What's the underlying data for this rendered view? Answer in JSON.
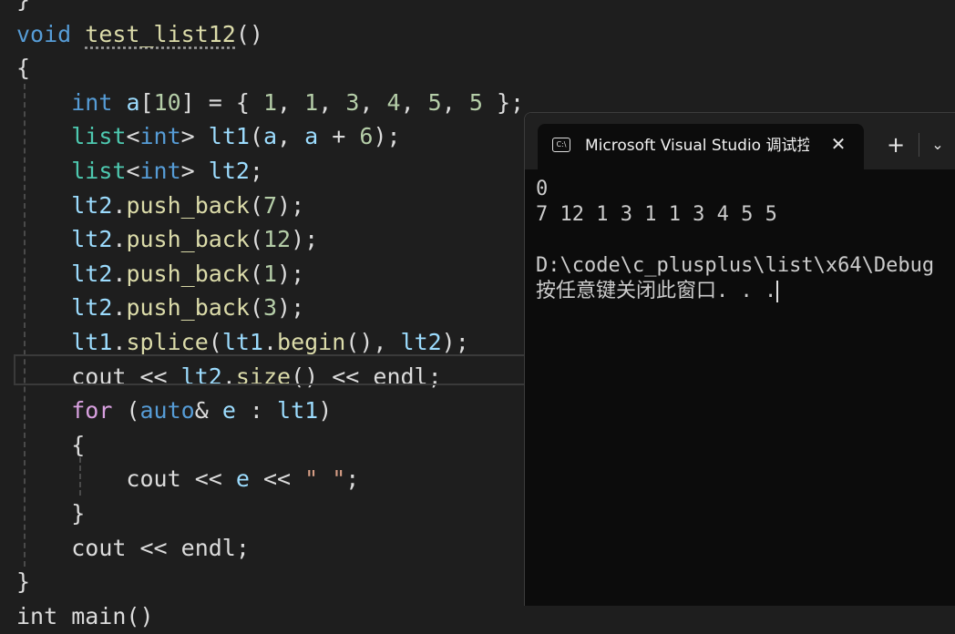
{
  "editor": {
    "lines": [
      {
        "tokens": [
          {
            "t": "}",
            "c": "pun"
          }
        ]
      },
      {
        "tokens": [
          {
            "t": "void",
            "c": "kw"
          },
          {
            "t": " ",
            "c": "pun"
          },
          {
            "t": "test_list12",
            "c": "fn squiggle"
          },
          {
            "t": "()",
            "c": "pun"
          }
        ]
      },
      {
        "tokens": [
          {
            "t": "{",
            "c": "pun"
          }
        ]
      },
      {
        "tokens": [
          {
            "t": "    ",
            "c": "pun"
          },
          {
            "t": "int",
            "c": "kw"
          },
          {
            "t": " ",
            "c": "pun"
          },
          {
            "t": "a",
            "c": "var"
          },
          {
            "t": "[",
            "c": "pun"
          },
          {
            "t": "10",
            "c": "num"
          },
          {
            "t": "] = { ",
            "c": "pun"
          },
          {
            "t": "1",
            "c": "num"
          },
          {
            "t": ", ",
            "c": "pun"
          },
          {
            "t": "1",
            "c": "num"
          },
          {
            "t": ", ",
            "c": "pun"
          },
          {
            "t": "3",
            "c": "num"
          },
          {
            "t": ", ",
            "c": "pun"
          },
          {
            "t": "4",
            "c": "num"
          },
          {
            "t": ", ",
            "c": "pun"
          },
          {
            "t": "5",
            "c": "num"
          },
          {
            "t": ", ",
            "c": "pun"
          },
          {
            "t": "5",
            "c": "num"
          },
          {
            "t": " };",
            "c": "pun"
          }
        ]
      },
      {
        "tokens": [
          {
            "t": "    ",
            "c": "pun"
          },
          {
            "t": "list",
            "c": "typ"
          },
          {
            "t": "<",
            "c": "pun"
          },
          {
            "t": "int",
            "c": "kw"
          },
          {
            "t": "> ",
            "c": "pun"
          },
          {
            "t": "lt1",
            "c": "var"
          },
          {
            "t": "(",
            "c": "pun"
          },
          {
            "t": "a",
            "c": "var"
          },
          {
            "t": ", ",
            "c": "pun"
          },
          {
            "t": "a",
            "c": "var"
          },
          {
            "t": " + ",
            "c": "pun"
          },
          {
            "t": "6",
            "c": "num"
          },
          {
            "t": ");",
            "c": "pun"
          }
        ]
      },
      {
        "tokens": [
          {
            "t": "    ",
            "c": "pun"
          },
          {
            "t": "list",
            "c": "typ"
          },
          {
            "t": "<",
            "c": "pun"
          },
          {
            "t": "int",
            "c": "kw"
          },
          {
            "t": "> ",
            "c": "pun"
          },
          {
            "t": "lt2",
            "c": "var"
          },
          {
            "t": ";",
            "c": "pun"
          }
        ]
      },
      {
        "tokens": [
          {
            "t": "    ",
            "c": "pun"
          },
          {
            "t": "lt2",
            "c": "var"
          },
          {
            "t": ".",
            "c": "pun"
          },
          {
            "t": "push_back",
            "c": "fn"
          },
          {
            "t": "(",
            "c": "pun"
          },
          {
            "t": "7",
            "c": "num"
          },
          {
            "t": ");",
            "c": "pun"
          }
        ]
      },
      {
        "tokens": [
          {
            "t": "    ",
            "c": "pun"
          },
          {
            "t": "lt2",
            "c": "var"
          },
          {
            "t": ".",
            "c": "pun"
          },
          {
            "t": "push_back",
            "c": "fn"
          },
          {
            "t": "(",
            "c": "pun"
          },
          {
            "t": "12",
            "c": "num"
          },
          {
            "t": ");",
            "c": "pun"
          }
        ]
      },
      {
        "tokens": [
          {
            "t": "    ",
            "c": "pun"
          },
          {
            "t": "lt2",
            "c": "var"
          },
          {
            "t": ".",
            "c": "pun"
          },
          {
            "t": "push_back",
            "c": "fn"
          },
          {
            "t": "(",
            "c": "pun"
          },
          {
            "t": "1",
            "c": "num"
          },
          {
            "t": ");",
            "c": "pun"
          }
        ]
      },
      {
        "tokens": [
          {
            "t": "    ",
            "c": "pun"
          },
          {
            "t": "lt2",
            "c": "var"
          },
          {
            "t": ".",
            "c": "pun"
          },
          {
            "t": "push_back",
            "c": "fn"
          },
          {
            "t": "(",
            "c": "pun"
          },
          {
            "t": "3",
            "c": "num"
          },
          {
            "t": ");",
            "c": "pun"
          }
        ]
      },
      {
        "tokens": [
          {
            "t": "    ",
            "c": "pun"
          },
          {
            "t": "lt1",
            "c": "var"
          },
          {
            "t": ".",
            "c": "pun"
          },
          {
            "t": "splice",
            "c": "fn"
          },
          {
            "t": "(",
            "c": "pun"
          },
          {
            "t": "lt1",
            "c": "var"
          },
          {
            "t": ".",
            "c": "pun"
          },
          {
            "t": "begin",
            "c": "fn"
          },
          {
            "t": "(), ",
            "c": "pun"
          },
          {
            "t": "lt2",
            "c": "var"
          },
          {
            "t": ");",
            "c": "pun"
          }
        ]
      },
      {
        "tokens": [
          {
            "t": "    ",
            "c": "pun"
          },
          {
            "t": "cout",
            "c": "pun"
          },
          {
            "t": " << ",
            "c": "pun"
          },
          {
            "t": "lt2",
            "c": "var"
          },
          {
            "t": ".",
            "c": "pun"
          },
          {
            "t": "size",
            "c": "fn"
          },
          {
            "t": "() << ",
            "c": "pun"
          },
          {
            "t": "endl",
            "c": "pun"
          },
          {
            "t": ";",
            "c": "pun"
          }
        ]
      },
      {
        "tokens": [
          {
            "t": "    ",
            "c": "pun"
          },
          {
            "t": "for",
            "c": "ctl"
          },
          {
            "t": " (",
            "c": "pun"
          },
          {
            "t": "auto",
            "c": "kw"
          },
          {
            "t": "& ",
            "c": "pun"
          },
          {
            "t": "e",
            "c": "var"
          },
          {
            "t": " : ",
            "c": "pun"
          },
          {
            "t": "lt1",
            "c": "var"
          },
          {
            "t": ")",
            "c": "pun"
          }
        ]
      },
      {
        "tokens": [
          {
            "t": "    ",
            "c": "pun"
          },
          {
            "t": "{",
            "c": "pun"
          }
        ]
      },
      {
        "tokens": [
          {
            "t": "        ",
            "c": "pun"
          },
          {
            "t": "cout",
            "c": "pun"
          },
          {
            "t": " << ",
            "c": "pun"
          },
          {
            "t": "e",
            "c": "var"
          },
          {
            "t": " << ",
            "c": "pun"
          },
          {
            "t": "\" \"",
            "c": "str"
          },
          {
            "t": ";",
            "c": "pun"
          }
        ]
      },
      {
        "tokens": [
          {
            "t": "    ",
            "c": "pun"
          },
          {
            "t": "}",
            "c": "pun"
          }
        ]
      },
      {
        "tokens": [
          {
            "t": "    ",
            "c": "pun"
          },
          {
            "t": "cout",
            "c": "pun"
          },
          {
            "t": " << ",
            "c": "pun"
          },
          {
            "t": "endl",
            "c": "pun"
          },
          {
            "t": ";",
            "c": "pun"
          }
        ]
      },
      {
        "tokens": [
          {
            "t": "}",
            "c": "pun"
          }
        ]
      },
      {
        "tokens": [
          {
            "t": "int main()",
            "c": "pun"
          }
        ]
      }
    ]
  },
  "terminal": {
    "tab_icon": "terminal-icon",
    "tab_icon_text": "C:\\",
    "tab_title": "Microsoft Visual Studio 调试控制台",
    "close_symbol": "✕",
    "new_tab_symbol": "+",
    "dropdown_symbol": "⌄",
    "output": [
      "0",
      "7 12 1 3 1 1 3 4 5 5",
      "",
      "D:\\code\\c_plusplus\\list\\x64\\Debug",
      "按任意键关闭此窗口. . ."
    ]
  }
}
